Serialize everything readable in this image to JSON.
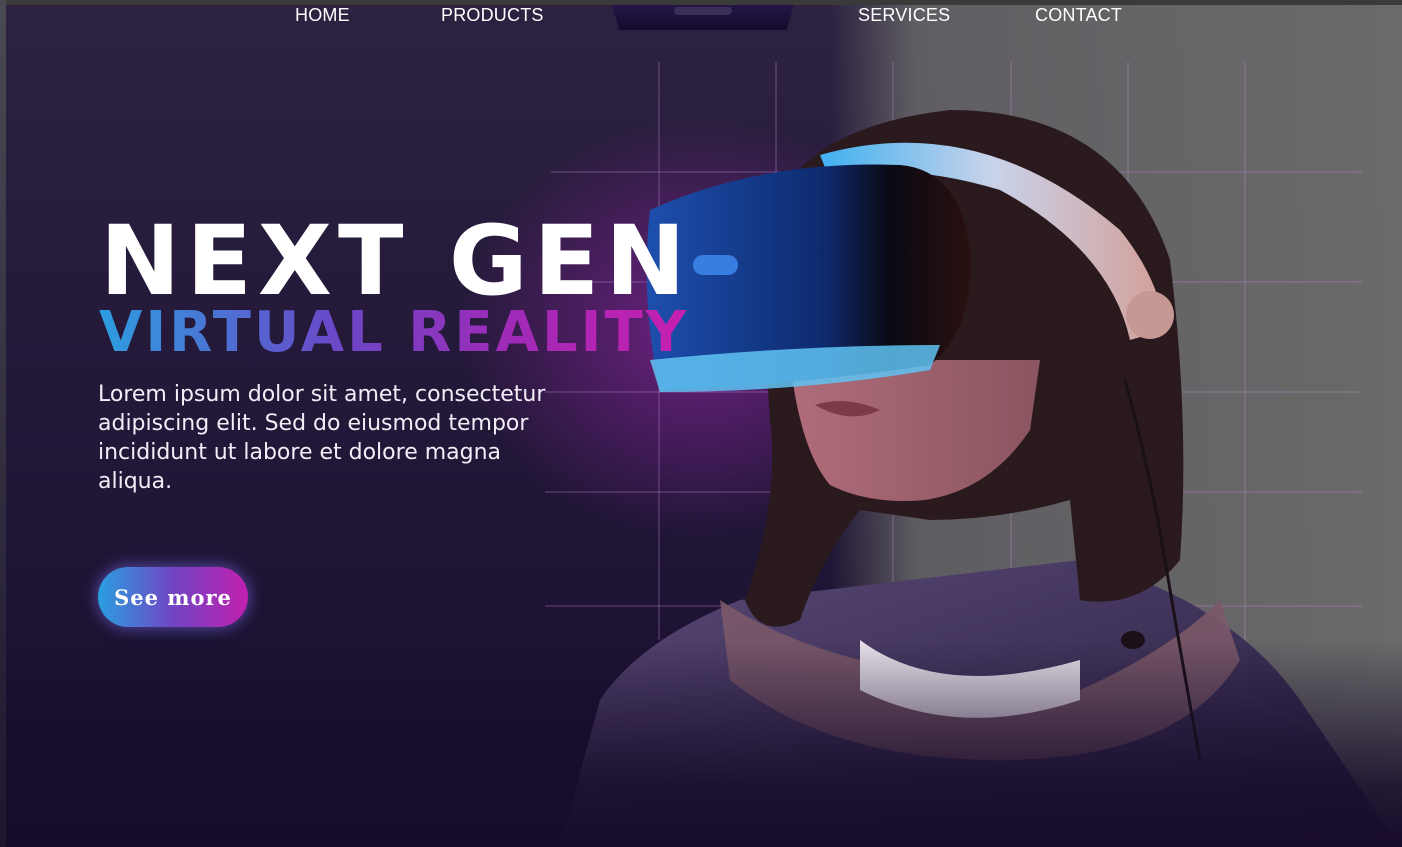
{
  "nav": {
    "items": [
      "HOME",
      "PRODUCTS",
      "SERVICES",
      "CONTACT"
    ]
  },
  "hero": {
    "title": "NEXT GEN",
    "subtitle": "VIRTUAL REALITY",
    "body": "Lorem ipsum dolor sit amet, consectetur adipiscing elit. Sed do eiusmod tempor incididunt ut labore et dolore magna aliqua.",
    "cta_label": "See more"
  },
  "colors": {
    "background": "#261a3b",
    "accent_blue": "#2d9de0",
    "accent_magenta": "#c71fae",
    "grid_line": "#b47ac8"
  },
  "icons": [
    "vr-headset-logo-icon"
  ]
}
